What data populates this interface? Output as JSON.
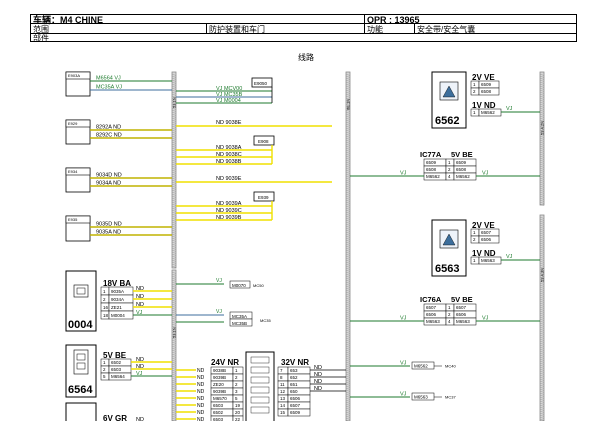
{
  "header": {
    "vehicle": "车辆：M4 CHINE",
    "opr": "OPR : 13965",
    "scope_label": "范围",
    "scope_value": "防护装置和车门",
    "function_label": "功能",
    "function_value": "安全带/安全气囊",
    "part_label": "部件",
    "diagram_title": "线路"
  },
  "colors": {
    "yellow_wire": "#f0e000",
    "green_wire": "#1c7a2c",
    "blue_wire": "#3c6e9c",
    "harness": "#8a8a8a",
    "label_green": "#1c7a2c"
  },
  "left_modules": [
    {
      "id": "E903A",
      "wires": [
        "M6564 VJ",
        "MC35A VJ"
      ]
    },
    {
      "id": "E929",
      "wires": [
        "8292A ND",
        "8292C ND"
      ]
    },
    {
      "id": "E934",
      "wires": [
        "9034D ND",
        "9034A ND"
      ]
    },
    {
      "id": "E935",
      "wires": [
        "9035D ND",
        "9035A ND"
      ]
    }
  ],
  "center_connectors": {
    "E9050": {
      "label": "E9050",
      "wires": [
        "VJ MCV00",
        "VJ MC35B",
        "VJ M0004"
      ]
    },
    "E908": {
      "label": "E908",
      "top_wire": "ND 9038E",
      "wires": [
        "ND 9038A",
        "ND 9038C",
        "ND 9038B"
      ]
    },
    "E939": {
      "label": "E939",
      "top_wire": "ND 9039E",
      "wires": [
        "ND 9039A",
        "ND 9039C",
        "ND 9039B"
      ]
    }
  },
  "component_0004": {
    "number": "0004",
    "connector": "18V BA",
    "pins": [
      {
        "pin": "1",
        "wire": "9035A",
        "color": "ND"
      },
      {
        "pin": "2",
        "wire": "9034A",
        "color": "ND"
      },
      {
        "pin": "16",
        "wire": "ZE21",
        "color": "ND"
      },
      {
        "pin": "18",
        "wire": "M0004",
        "color": "VJ"
      }
    ]
  },
  "component_6564": {
    "number": "6564",
    "connector": "5V BE",
    "pins": [
      {
        "pin": "1",
        "wire": "6502",
        "color": "ND"
      },
      {
        "pin": "2",
        "wire": "6503",
        "color": "ND"
      },
      {
        "pin": "5",
        "wire": "M6564",
        "color": "VJ"
      }
    ],
    "next_connector": "6V GR",
    "next_color": "ND"
  },
  "middle_links": [
    {
      "color": "VJ",
      "wire": "M0070",
      "target": "MC50"
    },
    {
      "color": "VJ",
      "wire": "MC35A",
      "target": "MC35"
    },
    {
      "color": "VJ",
      "wire": "MC35B",
      "target": ""
    }
  ],
  "connector_24v": {
    "label": "24V NR",
    "rows": [
      {
        "color": "ND",
        "wire": "9038B",
        "pin": "1"
      },
      {
        "color": "ND",
        "wire": "9039B",
        "pin": "2"
      },
      {
        "color": "ND",
        "wire": "ZE20",
        "pin": "2"
      },
      {
        "color": "ND",
        "wire": "9039B",
        "pin": "3"
      },
      {
        "color": "ND",
        "wire": "M6570",
        "pin": "5"
      },
      {
        "color": "ND",
        "wire": "6503",
        "pin": "19"
      },
      {
        "color": "ND",
        "wire": "6502",
        "pin": "20"
      },
      {
        "color": "ND",
        "wire": "6503",
        "pin": "22"
      }
    ]
  },
  "connector_32v": {
    "label": "32V NR",
    "rows": [
      {
        "pin": "7",
        "wire": "653",
        "color": "ND"
      },
      {
        "pin": "8",
        "wire": "652",
        "color": "ND"
      },
      {
        "pin": "11",
        "wire": "651",
        "color": "ND"
      },
      {
        "pin": "12",
        "wire": "650",
        "color": "ND"
      },
      {
        "pin": "13",
        "wire": "6506",
        "color": ""
      },
      {
        "pin": "14",
        "wire": "6507",
        "color": ""
      },
      {
        "pin": "15",
        "wire": "6509",
        "color": ""
      }
    ]
  },
  "component_6562": {
    "number": "6562",
    "connector_top": "2V VE",
    "pins_top": [
      {
        "pin": "1",
        "wire": "6509"
      },
      {
        "pin": "2",
        "wire": "6508"
      }
    ],
    "connector_bottom": "1V ND",
    "pins_bottom": [
      {
        "pin": "1",
        "wire": "M6562"
      }
    ],
    "wire_color": "VJ"
  },
  "component_6563": {
    "number": "6563",
    "connector_top": "2V VE",
    "pins_top": [
      {
        "pin": "1",
        "wire": "6507"
      },
      {
        "pin": "2",
        "wire": "6506"
      }
    ],
    "connector_bottom": "1V ND",
    "pins_bottom": [
      {
        "pin": "1",
        "wire": "M6563"
      }
    ],
    "wire_color": "VJ"
  },
  "splice_ic77a": {
    "left": "IC77A",
    "right": "5V BE",
    "rows": [
      {
        "l": "6509",
        "pin": "1",
        "r": "6509"
      },
      {
        "l": "6508",
        "pin": "2",
        "r": "6508"
      },
      {
        "l": "M6562",
        "pin": "4",
        "r": "M6562"
      }
    ],
    "wire_color": "VJ"
  },
  "splice_ic76a": {
    "left": "IC76A",
    "right": "5V BE",
    "rows": [
      {
        "l": "6507",
        "pin": "1",
        "r": "6507"
      },
      {
        "l": "6506",
        "pin": "2",
        "r": "6506"
      },
      {
        "l": "M6563",
        "pin": "4",
        "r": "M6563"
      }
    ],
    "wire_color": "VJ"
  },
  "right_links": [
    {
      "color": "VJ",
      "wire": "M6562",
      "target": "MC40"
    },
    {
      "color": "VJ",
      "wire": "M6563",
      "target": "MC37"
    }
  ],
  "harness_labels": {
    "left_top": "53.1N",
    "left_bottom": "53.1N",
    "middle": "6E.1N",
    "right_top": "53.4.2N",
    "right_bottom": "53.4.3N"
  }
}
